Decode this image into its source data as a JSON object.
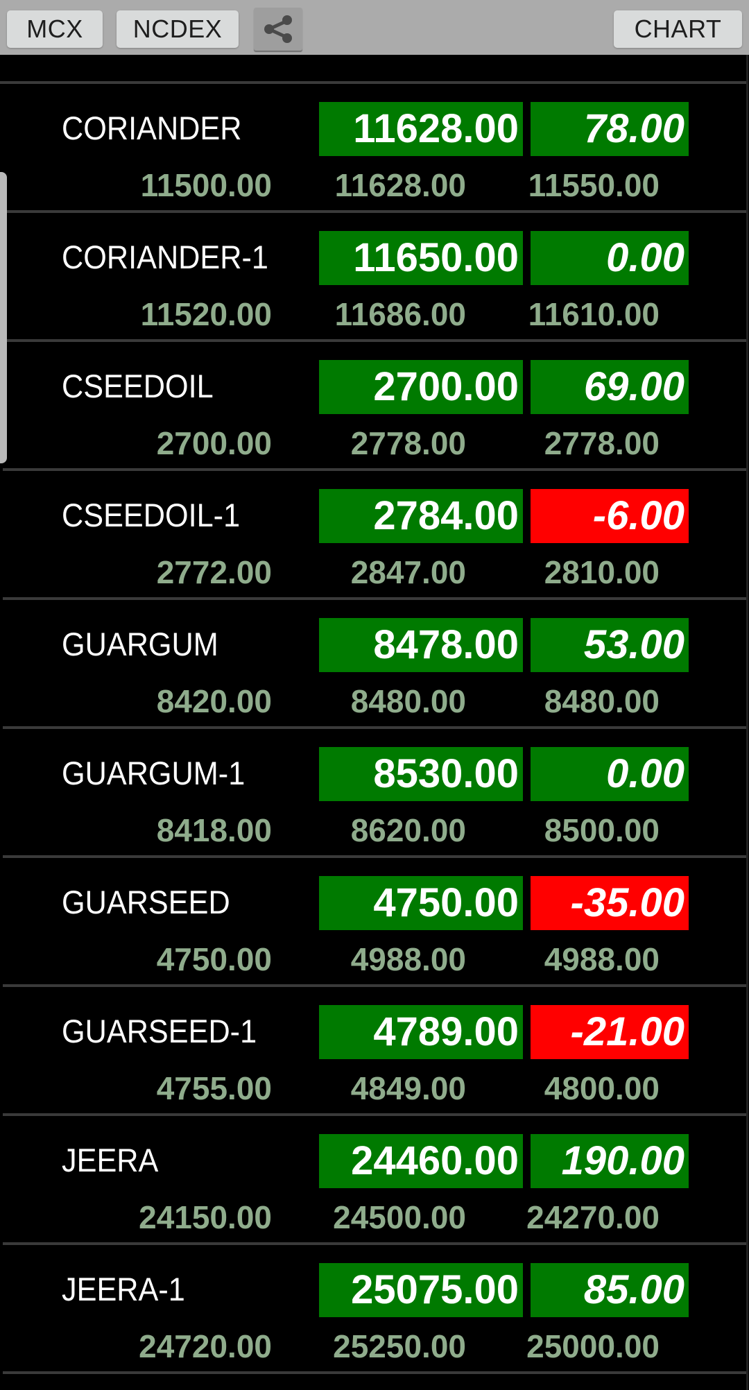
{
  "toolbar": {
    "mcx_label": "MCX",
    "ncdex_label": "NCDEX",
    "share_icon": "share-icon",
    "chart_label": "CHART"
  },
  "colors": {
    "up": "#007a00",
    "down": "#ff0000",
    "sub_text": "#8fac8c",
    "toolbar_bg": "#ababab"
  },
  "rows": [
    {
      "name": "CORIANDER",
      "price": "11628.00",
      "change": "78.00",
      "direction": "up",
      "low": "11500.00",
      "high": "11628.00",
      "open": "11550.00"
    },
    {
      "name": "CORIANDER-1",
      "price": "11650.00",
      "change": "0.00",
      "direction": "up",
      "low": "11520.00",
      "high": "11686.00",
      "open": "11610.00"
    },
    {
      "name": "CSEEDOIL",
      "price": "2700.00",
      "change": "69.00",
      "direction": "up",
      "low": "2700.00",
      "high": "2778.00",
      "open": "2778.00"
    },
    {
      "name": "CSEEDOIL-1",
      "price": "2784.00",
      "change": "-6.00",
      "direction": "down",
      "low": "2772.00",
      "high": "2847.00",
      "open": "2810.00"
    },
    {
      "name": "GUARGUM",
      "price": "8478.00",
      "change": "53.00",
      "direction": "up",
      "low": "8420.00",
      "high": "8480.00",
      "open": "8480.00"
    },
    {
      "name": "GUARGUM-1",
      "price": "8530.00",
      "change": "0.00",
      "direction": "up",
      "low": "8418.00",
      "high": "8620.00",
      "open": "8500.00"
    },
    {
      "name": "GUARSEED",
      "price": "4750.00",
      "change": "-35.00",
      "direction": "down",
      "low": "4750.00",
      "high": "4988.00",
      "open": "4988.00"
    },
    {
      "name": "GUARSEED-1",
      "price": "4789.00",
      "change": "-21.00",
      "direction": "down",
      "low": "4755.00",
      "high": "4849.00",
      "open": "4800.00"
    },
    {
      "name": "JEERA",
      "price": "24460.00",
      "change": "190.00",
      "direction": "up",
      "low": "24150.00",
      "high": "24500.00",
      "open": "24270.00"
    },
    {
      "name": "JEERA-1",
      "price": "25075.00",
      "change": "85.00",
      "direction": "up",
      "low": "24720.00",
      "high": "25250.00",
      "open": "25000.00"
    }
  ]
}
